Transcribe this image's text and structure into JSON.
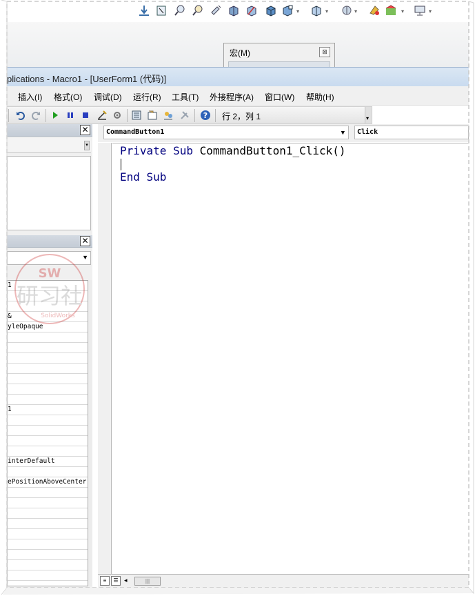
{
  "sw_toolbar": {
    "icons": [
      "arrow-down-icon",
      "sketch-icon",
      "zoom-fit-icon",
      "zoom-area-icon",
      "rotate-icon",
      "section-view-icon",
      "view-orientation-icon",
      "cube-icon",
      "display-style-icon",
      "view-cube-icon",
      "hide-show-icon",
      "appearance-icon",
      "scene-icon",
      "monitor-icon"
    ]
  },
  "macro_popup": {
    "title": "宏(M)",
    "close_glyph": "⊠"
  },
  "vbe": {
    "title": "plications - Macro1 - [UserForm1 (代码)]"
  },
  "menubar": {
    "items": [
      "插入(I)",
      "格式(O)",
      "调试(D)",
      "运行(R)",
      "工具(T)",
      "外接程序(A)",
      "窗口(W)",
      "帮助(H)"
    ]
  },
  "stdbar": {
    "row_col": "行 2，列 1"
  },
  "left_panes": {
    "close_glyph": "✕",
    "properties": [
      "1",
      "",
      "",
      "&",
      "yleOpaque",
      "",
      "",
      "",
      "",
      "",
      "",
      "",
      "1",
      "",
      "",
      "",
      "",
      "interDefault",
      "",
      "ePositionAboveCenter",
      "",
      "",
      "",
      "",
      "",
      "",
      "",
      "",
      "",
      ""
    ]
  },
  "watermark": {
    "top": "SW",
    "main": "研习社",
    "sub": "SolidWorks"
  },
  "code": {
    "object": "CommandButton1",
    "procedure": "Click",
    "line1_kw": "Private Sub",
    "line1_rest": " CommandButton1_Click()",
    "line3": "End Sub"
  },
  "colors": {
    "keyword": "#00007f",
    "title_bar": "#c9dbef",
    "run_green": "#1f9e1f",
    "stop_blue": "#2a3fbf"
  }
}
